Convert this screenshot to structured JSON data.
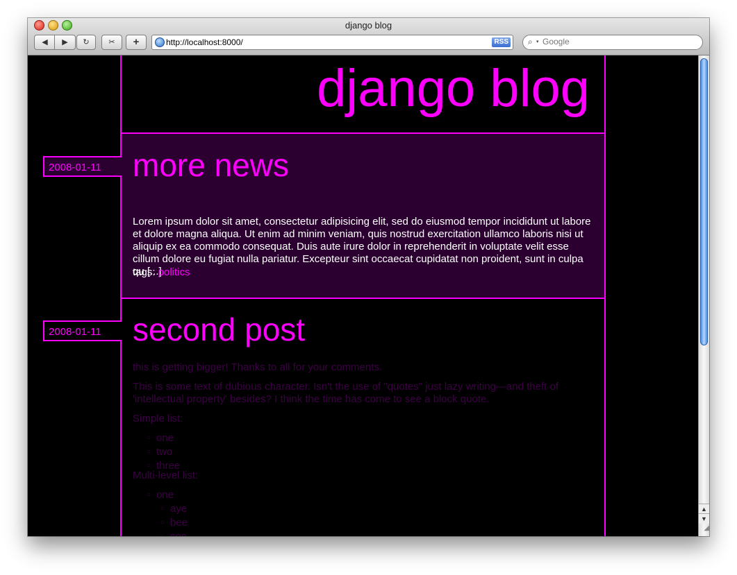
{
  "window": {
    "title": "django blog"
  },
  "toolbar": {
    "back_icon": "◀",
    "forward_icon": "▶",
    "reload_icon": "↻",
    "snap_icon": "✂",
    "add_icon": "+",
    "url": "http://localhost:8000/",
    "rss_label": "RSS",
    "search_placeholder": "Google"
  },
  "site": {
    "title": "django blog"
  },
  "posts": [
    {
      "date": "2008-01-11",
      "title": "more news",
      "body": "Lorem ipsum dolor sit amet, consectetur adipisicing elit, sed do eiusmod tempor incididunt ut labore et dolore magna aliqua. Ut enim ad minim veniam, quis nostrud exercitation ullamco laboris nisi ut aliquip ex ea commodo consequat. Duis aute irure dolor in reprehenderit in voluptate velit esse cillum dolore eu fugiat nulla pariatur. Excepteur sint occaecat cupidatat non proident, sunt in culpa qu [...]",
      "tags_label": "tags:",
      "tags": [
        "politics"
      ]
    },
    {
      "date": "2008-01-11",
      "title": "second post",
      "paragraphs": [
        "this is getting bigger! Thanks to all for your comments.",
        "This is some text of dubious character. Isn't the use of \"quotes\" just lazy writing—and theft of 'intellectual property' besides? I think the time has come to see a block quote.",
        "Simple list:",
        "Multi-level list:"
      ],
      "simple_list": [
        "one",
        "two",
        "three"
      ],
      "multi_list": {
        "top": "one",
        "sub": [
          "aye",
          "bee",
          "see"
        ]
      }
    }
  ],
  "colors": {
    "accent": "#ff00ff",
    "post_bg": "#2b0031",
    "page_bg": "#000000",
    "faded_text": "#3d0045"
  }
}
